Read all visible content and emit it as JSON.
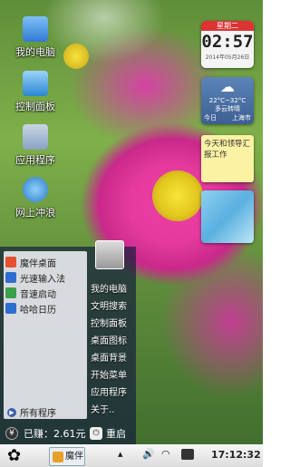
{
  "desktop_icons": [
    {
      "label": "我的电脑",
      "icon": "computer-icon"
    },
    {
      "label": "控制面板",
      "icon": "control-panel-icon"
    },
    {
      "label": "应用程序",
      "icon": "apps-icon"
    },
    {
      "label": "网上冲浪",
      "icon": "globe-icon"
    }
  ],
  "clock_widget": {
    "day": "星期二",
    "time": "02:57",
    "date": "2014年05月26日"
  },
  "weather_widget": {
    "temp": "22°C~32°C",
    "desc": "多云转晴",
    "today": "今日",
    "city": "上海市"
  },
  "note_widget": {
    "text": "今天和领导汇报工作"
  },
  "start_menu": {
    "programs": [
      {
        "label": "魔伴桌面",
        "icon": "mobanzhuomian-icon",
        "color": "#e5502f"
      },
      {
        "label": "光速输入法",
        "icon": "input-method-icon",
        "color": "#2f6ed1"
      },
      {
        "label": "音速启动",
        "icon": "launcher-icon",
        "color": "#3aa04a"
      },
      {
        "label": "哈哈日历",
        "icon": "calendar-icon",
        "color": "#2f6ed1"
      }
    ],
    "all_programs": "所有程序",
    "right_items": [
      "我的电脑",
      "文明搜索",
      "控制面板",
      "桌面图标",
      "桌面背景",
      "开始菜单",
      "应用程序",
      "关于.."
    ],
    "earnings": "已赚：2.61元",
    "restart": "重启"
  },
  "taskbar": {
    "app_label": "魔伴",
    "time": "17:12:32",
    "tray_icons": [
      "up-arrow-icon",
      "volume-icon",
      "wifi-icon",
      "battery-icon"
    ]
  }
}
